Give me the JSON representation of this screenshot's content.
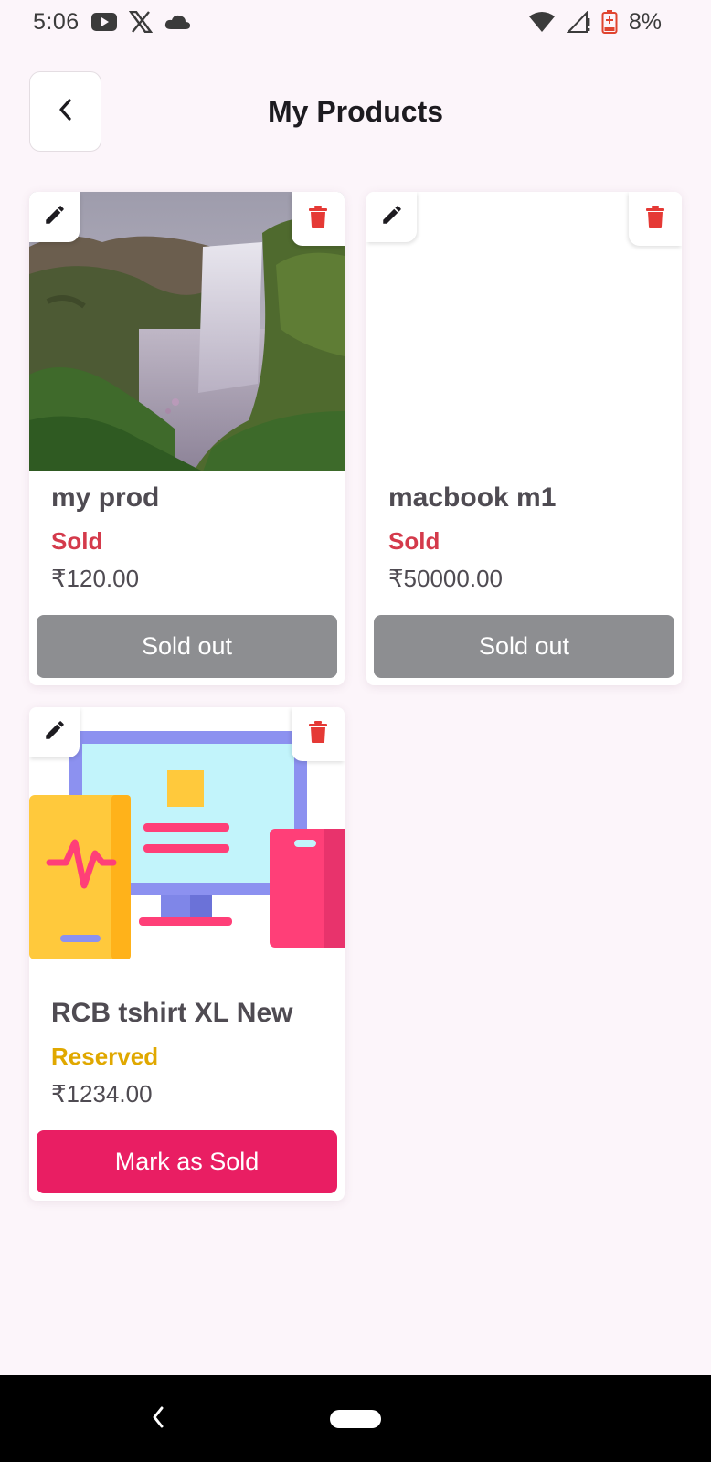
{
  "status_bar": {
    "time": "5:06",
    "battery_percent": "8%",
    "icons": [
      "youtube-icon",
      "x-logo-icon",
      "cloud-icon",
      "wifi-icon",
      "cellular-signal-icon",
      "battery-low-icon"
    ]
  },
  "app_bar": {
    "title": "My Products",
    "back_icon": "chevron-left-icon"
  },
  "products": [
    {
      "name": "my prod",
      "status": "Sold",
      "status_color": "#d43a4b",
      "price": "₹120.00",
      "action_label": "Sold out",
      "action_color": "#8d8e91",
      "image": "waterfall-photo"
    },
    {
      "name": "macbook m1",
      "status": "Sold",
      "status_color": "#d43a4b",
      "price": "₹50000.00",
      "action_label": "Sold out",
      "action_color": "#8d8e91",
      "image": "blank"
    },
    {
      "name": "RCB tshirt XL New",
      "status": "Reserved",
      "status_color": "#e0a800",
      "price": "₹1234.00",
      "action_label": "Mark as Sold",
      "action_color": "#e91e63",
      "image": "devices-illustration"
    }
  ],
  "card_icons": {
    "edit": "pencil-icon",
    "delete": "trash-icon"
  },
  "colors": {
    "background": "#fcf5fa",
    "delete_icon": "#e53935",
    "accent": "#e91e63"
  }
}
